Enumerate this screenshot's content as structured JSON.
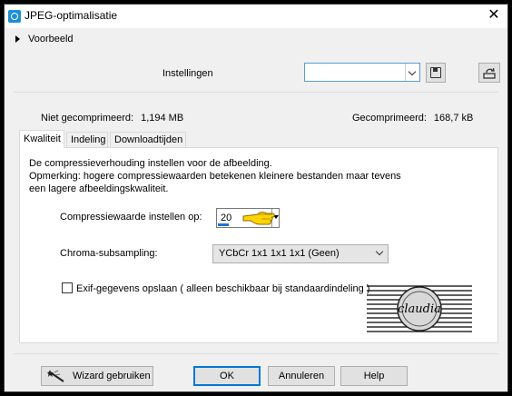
{
  "window": {
    "title": "JPEG-optimalisatie",
    "icons": {
      "app": "camera-icon",
      "close": "close-icon"
    }
  },
  "preview": {
    "label": "Voorbeeld",
    "icon": "expand-arrow-icon"
  },
  "settings": {
    "label": "Instellingen",
    "combo_value": "",
    "icons": {
      "save": "floppy-disk-icon",
      "load": "load-preset-icon"
    }
  },
  "stats": {
    "uncompressed_label": "Niet gecomprimeerd:",
    "uncompressed_value": "1,194 MB",
    "compressed_label": "Gecomprimeerd:",
    "compressed_value": "168,7 kB"
  },
  "tabs": [
    {
      "label": "Kwaliteit",
      "active": true
    },
    {
      "label": "Indeling",
      "active": false
    },
    {
      "label": "Downloadtijden",
      "active": false
    }
  ],
  "quality": {
    "intro_line1": "De compressieverhouding instellen voor de afbeelding.",
    "intro_line2": "Opmerking:  hogere compressiewaarden betekenen kleinere bestanden maar tevens",
    "intro_line3": "een lagere afbeeldingskwaliteit.",
    "compression_label": "Compressiewaarde instellen op:",
    "compression_value": "20",
    "compression_level_fraction": 0.2,
    "chroma_label": "Chroma-subsampling:",
    "chroma_value": "YCbCr  1x1  1x1  1x1  (Geen)",
    "exif_label": "Exif-gegevens opslaan ( alleen beschikbaar bij standaardindeling )",
    "exif_checked": false,
    "watermark_text": "claudia",
    "pointer_icon": "pointing-hand-icon"
  },
  "buttons": {
    "wizard": "Wizard gebruiken",
    "wizard_icon": "magic-wand-icon",
    "ok": "OK",
    "cancel": "Annuleren",
    "help": "Help"
  },
  "colors": {
    "accent": "#0078d7",
    "progress": "#1e73d6",
    "window_bg": "#f0f0f0"
  }
}
